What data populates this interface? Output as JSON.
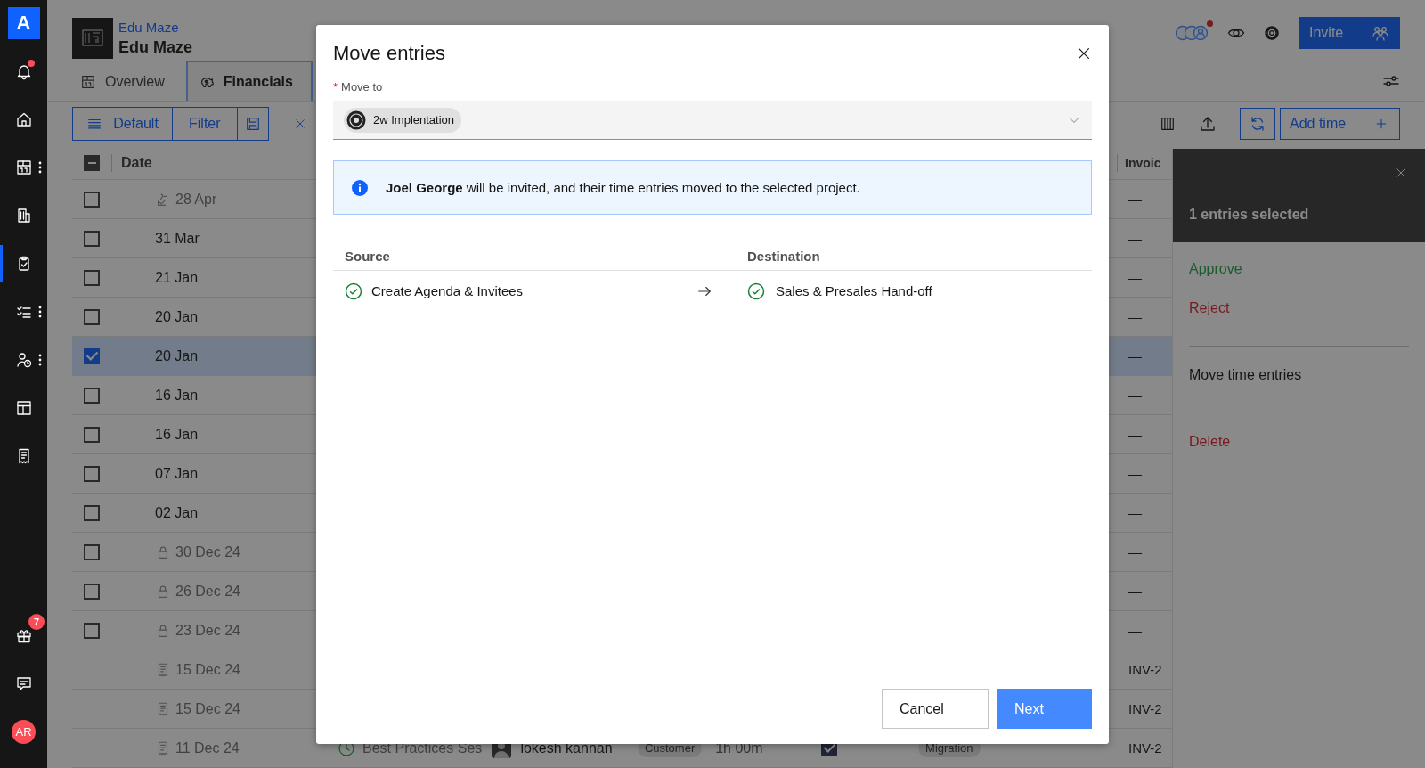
{
  "nav": {
    "logo": "A",
    "items": [
      {
        "kind": "bell",
        "selected": false,
        "alert": true,
        "menu": false
      },
      {
        "kind": "home",
        "selected": false,
        "alert": false,
        "menu": false
      },
      {
        "kind": "calendar",
        "selected": false,
        "alert": false,
        "menu": true
      },
      {
        "kind": "building",
        "selected": false,
        "alert": false,
        "menu": false
      },
      {
        "kind": "clipboard",
        "selected": true,
        "alert": false,
        "menu": false
      },
      {
        "kind": "checklist",
        "selected": false,
        "alert": false,
        "menu": true
      },
      {
        "kind": "person-clock",
        "selected": false,
        "alert": false,
        "menu": true
      },
      {
        "kind": "layout",
        "selected": false,
        "alert": false,
        "menu": false
      },
      {
        "kind": "receipt",
        "selected": false,
        "alert": false,
        "menu": false
      }
    ],
    "bottom_items": [
      {
        "kind": "gift",
        "badge": "7"
      },
      {
        "kind": "chat"
      }
    ],
    "avatar": "AR"
  },
  "project": {
    "breadcrumb": "Edu Maze",
    "title": "Edu Maze",
    "tabs": [
      {
        "label": "Overview",
        "kind": "calendar",
        "selected": false
      },
      {
        "label": "Financials",
        "kind": "piggy",
        "selected": true
      }
    ],
    "team_alert": true,
    "invite": "Invite"
  },
  "toolbar": {
    "view": "Default",
    "filter": "Filter",
    "add_time": "Add time"
  },
  "table": {
    "select_all_partial": true,
    "columns": [
      {
        "label": "Date"
      },
      {
        "label": "Invoic"
      }
    ],
    "rows": [
      {
        "date": "28 Apr",
        "kind": "signed",
        "selected": false,
        "invoice": "—"
      },
      {
        "date": "31 Mar",
        "kind": "open",
        "selected": false,
        "invoice": "—"
      },
      {
        "date": "21 Jan",
        "kind": "open",
        "selected": false,
        "invoice": "—"
      },
      {
        "date": "20 Jan",
        "kind": "open",
        "selected": false,
        "invoice": "—"
      },
      {
        "date": "20 Jan",
        "kind": "open",
        "selected": true,
        "invoice": "—"
      },
      {
        "date": "16 Jan",
        "kind": "open",
        "selected": false,
        "invoice": "—"
      },
      {
        "date": "16 Jan",
        "kind": "open",
        "selected": false,
        "invoice": "—"
      },
      {
        "date": "07 Jan",
        "kind": "open",
        "selected": false,
        "invoice": "—"
      },
      {
        "date": "02 Jan",
        "kind": "open",
        "selected": false,
        "invoice": "—"
      },
      {
        "date": "30 Dec 24",
        "kind": "locked",
        "selected": false,
        "invoice": "—"
      },
      {
        "date": "26 Dec 24",
        "kind": "locked",
        "selected": false,
        "invoice": "—"
      },
      {
        "date": "23 Dec 24",
        "kind": "locked",
        "selected": false,
        "invoice": "—"
      },
      {
        "date": "15 Dec 24",
        "kind": "invoiced",
        "selected": false,
        "invoice": "INV-2"
      },
      {
        "date": "15 Dec 24",
        "kind": "invoiced",
        "selected": false,
        "invoice": "INV-2"
      },
      {
        "date": "11 Dec 24",
        "kind": "invoiced",
        "selected": false,
        "invoice": "INV-2",
        "task": "Best Practices Ses",
        "person": "lokesh kannan",
        "type": "Customer",
        "duration": "1h 00m",
        "billable": true,
        "tag": "Migration"
      }
    ]
  },
  "selection_panel": {
    "title": "1 entries selected",
    "groups": [
      {
        "actions": [
          {
            "label": "Approve",
            "kind": "positive"
          },
          {
            "label": "Reject",
            "kind": "danger"
          }
        ]
      },
      {
        "actions": [
          {
            "label": "Move time entries",
            "kind": "neutral"
          }
        ]
      },
      {
        "actions": [
          {
            "label": "Delete",
            "kind": "danger"
          }
        ]
      }
    ]
  },
  "modal": {
    "title": "Move entries",
    "field": {
      "required_mark": "*",
      "label": "Move to",
      "value": "2w Implentation"
    },
    "notice": "**Joel George** will be invited, and their time entries moved to the selected project.",
    "mapping": {
      "columns": [
        "Source",
        "Destination"
      ],
      "rows": [
        {
          "source": "Create Agenda & Invitees",
          "destination": "Sales & Presales Hand-off"
        }
      ]
    },
    "buttons": [
      {
        "label": "Cancel",
        "kind": "secondary"
      },
      {
        "label": "Next",
        "kind": "primary"
      }
    ]
  }
}
